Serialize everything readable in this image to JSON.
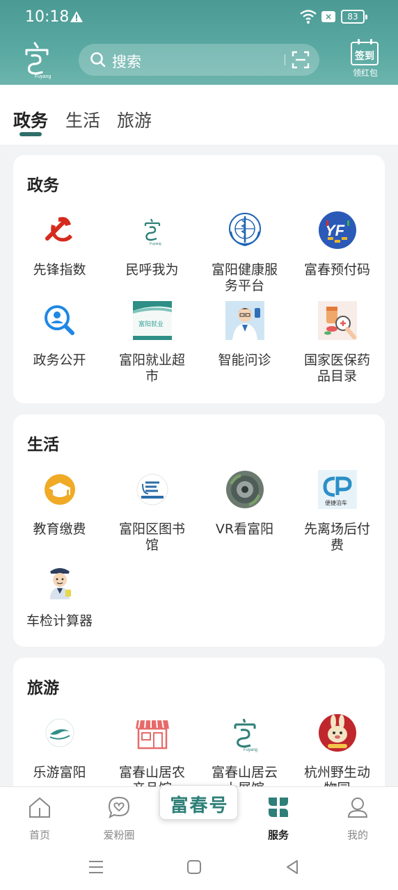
{
  "status_bar": {
    "time": "10:18",
    "battery": "83"
  },
  "header": {
    "search_placeholder": "搜索",
    "checkin_label": "签到",
    "checkin_sub": "领红包"
  },
  "tabs": [
    {
      "label": "政务",
      "active": true
    },
    {
      "label": "生活",
      "active": false
    },
    {
      "label": "旅游",
      "active": false
    }
  ],
  "sections": {
    "gov": {
      "title": "政务",
      "items": [
        {
          "label": "先锋指数",
          "icon": "party-emblem-icon"
        },
        {
          "label": "民呼我为",
          "icon": "fuyang-logo-icon"
        },
        {
          "label": "富阳健康服务平台",
          "icon": "who-emblem-icon"
        },
        {
          "label": "富春预付码",
          "icon": "yf-badge-icon"
        },
        {
          "label": "政务公开",
          "icon": "magnifier-person-icon"
        },
        {
          "label": "富阳就业超市",
          "icon": "employment-banner-icon"
        },
        {
          "label": "智能问诊",
          "icon": "doctor-icon"
        },
        {
          "label": "国家医保药品目录",
          "icon": "medicine-icon"
        }
      ]
    },
    "life": {
      "title": "生活",
      "items": [
        {
          "label": "教育缴费",
          "icon": "graduation-cap-icon"
        },
        {
          "label": "富阳区图书馆",
          "icon": "library-logo-icon"
        },
        {
          "label": "VR看富阳",
          "icon": "vr-panorama-icon"
        },
        {
          "label": "先离场后付费",
          "icon": "parking-icon"
        },
        {
          "label": "车检计算器",
          "icon": "traffic-police-icon"
        }
      ]
    },
    "travel": {
      "title": "旅游",
      "items": [
        {
          "label": "乐游富阳",
          "icon": "boat-logo-icon"
        },
        {
          "label": "富春山居农产品馆",
          "icon": "shop-icon"
        },
        {
          "label": "富春山居云上展馆",
          "icon": "fuyang-logo-icon"
        },
        {
          "label": "杭州野生动物园",
          "icon": "rabbit-mascot-icon"
        }
      ]
    }
  },
  "bottom_nav": {
    "items": [
      {
        "label": "首页",
        "icon": "home-icon"
      },
      {
        "label": "爱粉圈",
        "icon": "heart-bubble-icon"
      },
      {
        "label": "服务",
        "icon": "services-icon",
        "active": true
      },
      {
        "label": "我的",
        "icon": "profile-icon"
      }
    ],
    "center_brand": "富春号"
  },
  "colors": {
    "accent": "#2f6f6a",
    "header": "#5aa9a2",
    "brand_green": "#2e7f77"
  }
}
